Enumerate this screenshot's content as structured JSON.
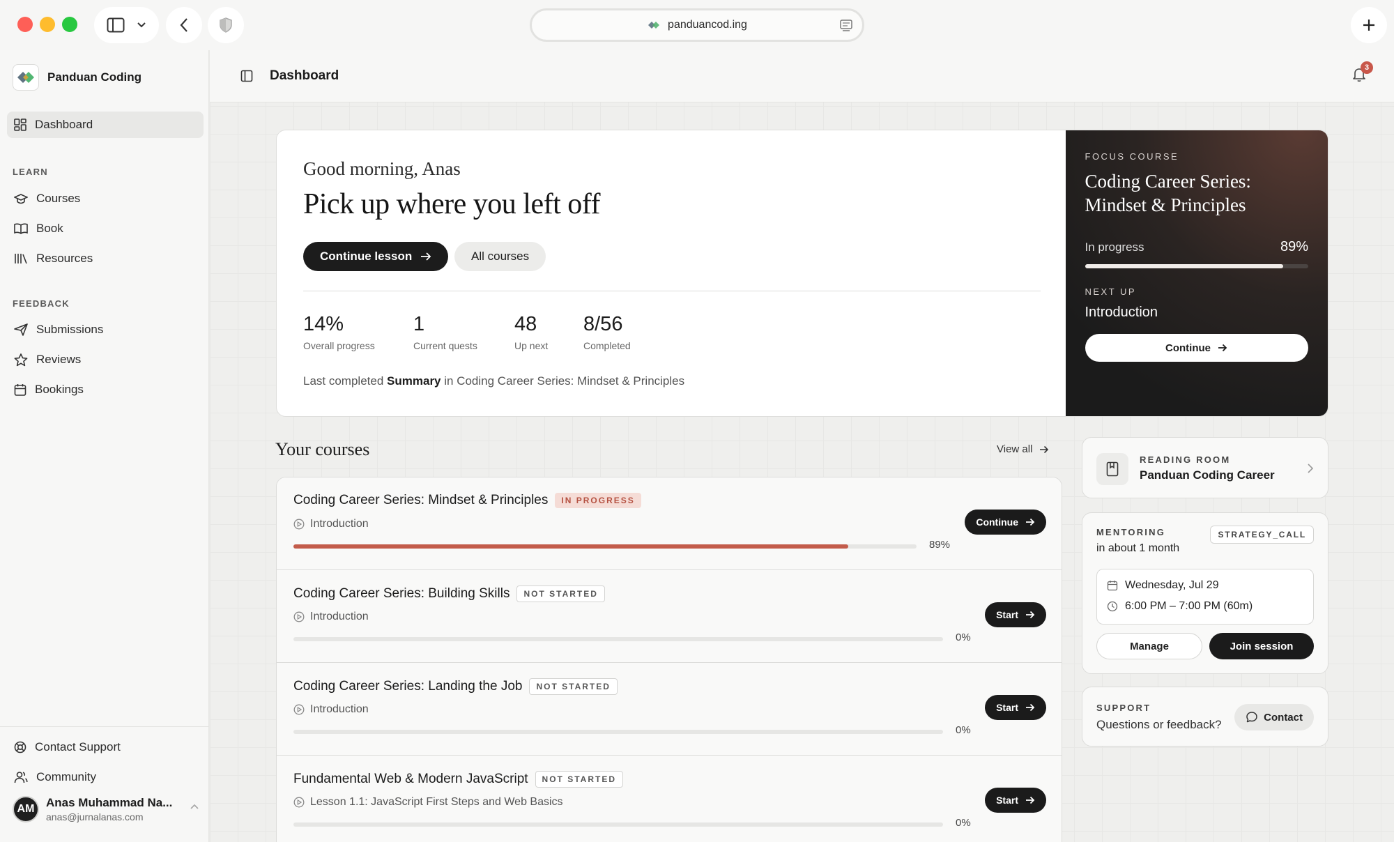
{
  "browser": {
    "url": "panduancod.ing"
  },
  "sidebar": {
    "brand": "Panduan Coding",
    "dashboard_label": "Dashboard",
    "learn_heading": "LEARN",
    "learn_items": [
      {
        "label": "Courses",
        "icon": "graduation-cap-icon"
      },
      {
        "label": "Book",
        "icon": "book-icon"
      },
      {
        "label": "Resources",
        "icon": "library-icon"
      }
    ],
    "feedback_heading": "FEEDBACK",
    "feedback_items": [
      {
        "label": "Submissions",
        "icon": "send-icon"
      },
      {
        "label": "Reviews",
        "icon": "star-icon"
      },
      {
        "label": "Bookings",
        "icon": "calendar-icon"
      }
    ],
    "bottom_items": [
      {
        "label": "Contact Support",
        "icon": "lifebuoy-icon"
      },
      {
        "label": "Community",
        "icon": "users-icon"
      }
    ],
    "user": {
      "initials": "AM",
      "name": "Anas Muhammad Na...",
      "email": "anas@jurnalanas.com"
    }
  },
  "topbar": {
    "title": "Dashboard",
    "notification_count": "3"
  },
  "hero": {
    "greeting": "Good morning, Anas",
    "headline": "Pick up where you left off",
    "continue_label": "Continue lesson",
    "all_courses_label": "All courses",
    "stats": [
      {
        "value": "14%",
        "label": "Overall progress"
      },
      {
        "value": "1",
        "label": "Current quests"
      },
      {
        "value": "48",
        "label": "Up next"
      },
      {
        "value": "8/56",
        "label": "Completed"
      }
    ],
    "last_completed_prefix": "Last completed",
    "last_completed_item": "Summary",
    "last_completed_suffix": "in Coding Career Series: Mindset & Principles"
  },
  "focus": {
    "label": "FOCUS COURSE",
    "title": "Coding Career Series: Mindset & Principles",
    "progress_label": "In progress",
    "progress_text": "89%",
    "progress": 0.89,
    "next_up_label": "NEXT UP",
    "next_up_title": "Introduction",
    "continue_label": "Continue"
  },
  "courses": {
    "heading": "Your courses",
    "view_all": "View all",
    "items": [
      {
        "title": "Coding Career Series: Mindset & Principles",
        "status": "IN PROGRESS",
        "lesson": "Introduction",
        "progress": 0.89,
        "progress_text": "89%",
        "action": "Continue"
      },
      {
        "title": "Coding Career Series: Building Skills",
        "status": "NOT STARTED",
        "lesson": "Introduction",
        "progress": 0,
        "progress_text": "0%",
        "action": "Start"
      },
      {
        "title": "Coding Career Series: Landing the Job",
        "status": "NOT STARTED",
        "lesson": "Introduction",
        "progress": 0,
        "progress_text": "0%",
        "action": "Start"
      },
      {
        "title": "Fundamental Web & Modern JavaScript",
        "status": "NOT STARTED",
        "lesson": "Lesson 1.1: JavaScript First Steps and Web Basics",
        "progress": 0,
        "progress_text": "0%",
        "action": "Start"
      }
    ]
  },
  "reading_room": {
    "label": "READING ROOM",
    "title": "Panduan Coding Career"
  },
  "mentoring": {
    "label": "MENTORING",
    "when": "in about 1 month",
    "tag": "STRATEGY_CALL",
    "date": "Wednesday, Jul 29",
    "time": "6:00 PM – 7:00 PM (60m)",
    "manage_label": "Manage",
    "join_label": "Join session"
  },
  "support": {
    "label": "SUPPORT",
    "text": "Questions or feedback?",
    "contact_label": "Contact"
  },
  "colors": {
    "accent": "#c35c4b",
    "dark": "#1b1b1b"
  }
}
